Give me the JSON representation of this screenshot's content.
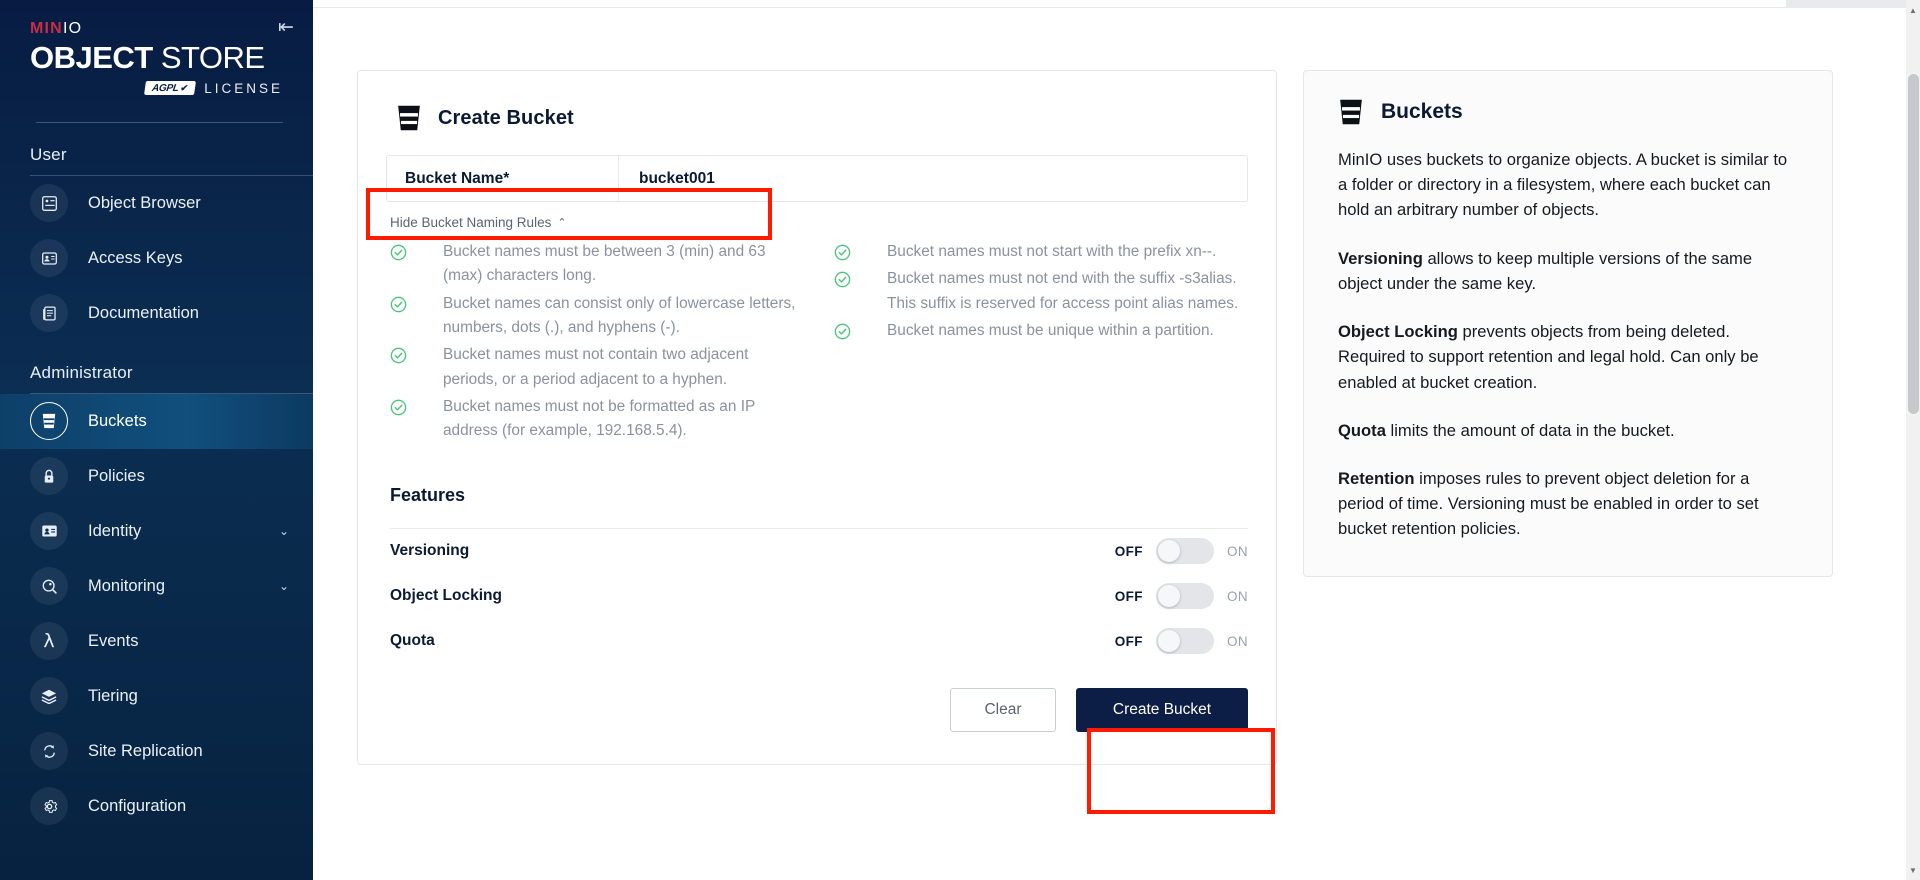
{
  "sidebar": {
    "brand": {
      "min": "MIN",
      "io": "IO",
      "object": "OBJECT",
      "store": "STORE",
      "agpl": "AGPL",
      "license": "LICENSE"
    },
    "collapse_icon": "collapse-panel-icon",
    "groups": [
      {
        "label": "User",
        "items": [
          {
            "label": "Object Browser",
            "icon": "object-browser-icon",
            "active": false,
            "expandable": false
          },
          {
            "label": "Access Keys",
            "icon": "access-keys-icon",
            "active": false,
            "expandable": false
          },
          {
            "label": "Documentation",
            "icon": "documentation-icon",
            "active": false,
            "expandable": false
          }
        ]
      },
      {
        "label": "Administrator",
        "items": [
          {
            "label": "Buckets",
            "icon": "bucket-icon",
            "active": true,
            "expandable": false
          },
          {
            "label": "Policies",
            "icon": "policies-lock-icon",
            "active": false,
            "expandable": false
          },
          {
            "label": "Identity",
            "icon": "identity-card-icon",
            "active": false,
            "expandable": true
          },
          {
            "label": "Monitoring",
            "icon": "monitoring-search-icon",
            "active": false,
            "expandable": true
          },
          {
            "label": "Events",
            "icon": "events-lambda-icon",
            "active": false,
            "expandable": false
          },
          {
            "label": "Tiering",
            "icon": "tiering-layers-icon",
            "active": false,
            "expandable": false
          },
          {
            "label": "Site Replication",
            "icon": "site-replication-icon",
            "active": false,
            "expandable": false
          },
          {
            "label": "Configuration",
            "icon": "configuration-gear-icon",
            "active": false,
            "expandable": false
          }
        ]
      }
    ]
  },
  "create_bucket": {
    "title": "Create Bucket",
    "title_icon": "bucket-icon",
    "bucket_name_label": "Bucket Name*",
    "bucket_name_value": "bucket001",
    "bucket_name_placeholder": "",
    "hide_rules_label": "Hide Bucket Naming Rules",
    "hide_rules_caret": "chevron-up-icon",
    "rules_left": [
      "Bucket names must be between 3 (min) and 63 (max) characters long.",
      "Bucket names can consist only of lowercase letters, numbers, dots (.), and hyphens (-).",
      "Bucket names must not contain two adjacent periods, or a period adjacent to a hyphen.",
      "Bucket names must not be formatted as an IP address (for example, 192.168.5.4)."
    ],
    "rules_right": [
      "Bucket names must not start with the prefix xn--.",
      "Bucket names must not end with the suffix -s3alias. This suffix is reserved for access point alias names.",
      "Bucket names must be unique within a partition."
    ],
    "features_title": "Features",
    "features": [
      {
        "name": "Versioning",
        "off_label": "OFF",
        "on_label": "ON",
        "state": "off"
      },
      {
        "name": "Object Locking",
        "off_label": "OFF",
        "on_label": "ON",
        "state": "off"
      },
      {
        "name": "Quota",
        "off_label": "OFF",
        "on_label": "ON",
        "state": "off"
      }
    ],
    "clear_button": "Clear",
    "create_button": "Create Bucket"
  },
  "info_panel": {
    "title": "Buckets",
    "title_icon": "bucket-icon",
    "paragraphs": [
      {
        "bold": "",
        "text": "MinIO uses buckets to organize objects. A bucket is similar to a folder or directory in a filesystem, where each bucket can hold an arbitrary number of objects."
      },
      {
        "bold": "Versioning",
        "text": " allows to keep multiple versions of the same object under the same key."
      },
      {
        "bold": "Object Locking",
        "text": " prevents objects from being deleted. Required to support retention and legal hold. Can only be enabled at bucket creation."
      },
      {
        "bold": "Quota",
        "text": " limits the amount of data in the bucket."
      },
      {
        "bold": "Retention",
        "text": " imposes rules to prevent object deletion for a period of time. Versioning must be enabled in order to set bucket retention policies."
      }
    ]
  },
  "annotations": {
    "bucket_name_highlight": "bucket-name-field-highlight",
    "create_button_highlight": "create-bucket-button-highlight",
    "accent_color": "#ff1a00"
  },
  "scrollbar": {
    "up": "▲",
    "down": "▼"
  }
}
